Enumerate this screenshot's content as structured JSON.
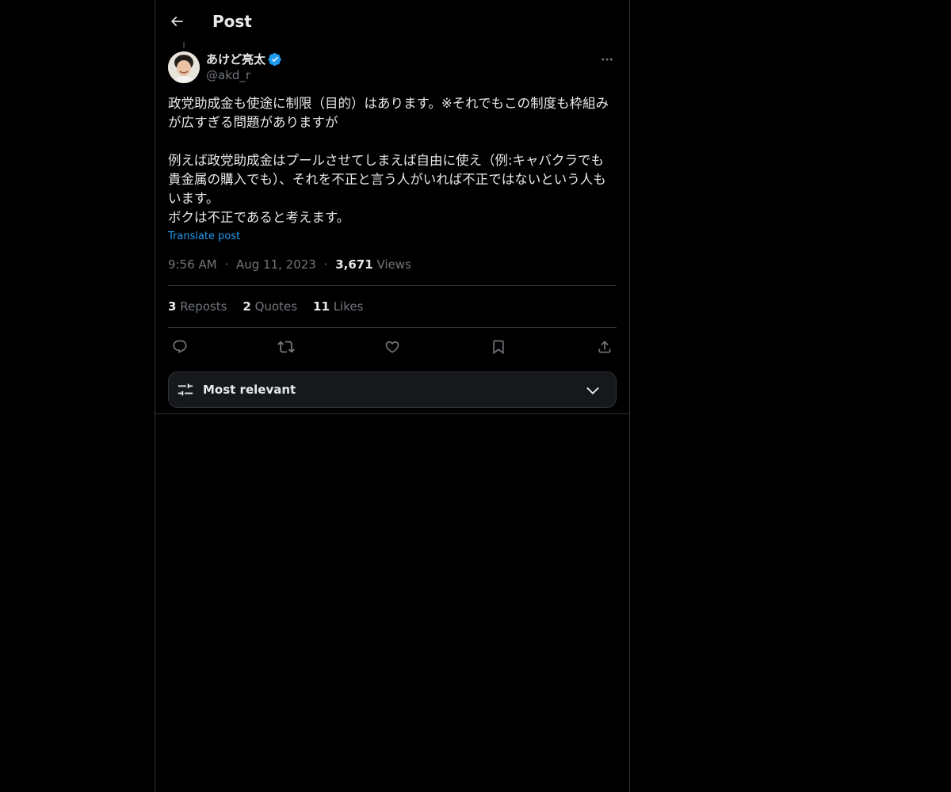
{
  "header": {
    "title": "Post"
  },
  "post": {
    "author": {
      "display_name": "あけど亮太",
      "handle": "@akd_r",
      "verified": true
    },
    "text": "政党助成金も使途に制限（目的）はあります。※それでもこの制度も枠組みが広すぎる問題がありますが\n\n例えば政党助成金はプールさせてしまえば自由に使え（例:キャバクラでも貴金属の購入でも）、それを不正と言う人がいれば不正ではないという人もいます。\nボクは不正であると考えます。",
    "translate_label": "Translate post",
    "time": "9:56 AM",
    "date": "Aug 11, 2023",
    "views_count": "3,671",
    "views_label": "Views",
    "separator": "·"
  },
  "stats": {
    "reposts_count": "3",
    "reposts_label": "Reposts",
    "quotes_count": "2",
    "quotes_label": "Quotes",
    "likes_count": "11",
    "likes_label": "Likes"
  },
  "sort": {
    "label": "Most relevant"
  },
  "colors": {
    "background": "#000000",
    "text": "#e7e9ea",
    "muted": "#71767b",
    "accent": "#1d9bf0",
    "border": "#2f3336"
  },
  "icons": {
    "back": "arrow-left-icon",
    "more": "more-dots-icon",
    "verified": "verified-badge-icon",
    "reply": "reply-icon",
    "repost": "repost-icon",
    "like": "heart-icon",
    "bookmark": "bookmark-icon",
    "share": "share-icon",
    "sort": "sliders-icon",
    "chevron": "chevron-down-icon"
  }
}
